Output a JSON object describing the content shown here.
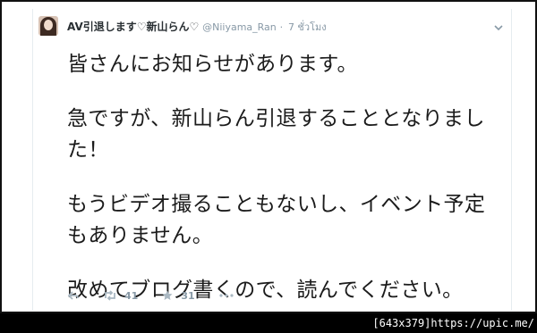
{
  "tweet": {
    "display_name": "AV引退します♡新山らん♡",
    "handle": "@Niiyama_Ran",
    "separator": "·",
    "time": "7 ชั่วโมง",
    "text_lines": [
      "皆さんにお知らせがあります。",
      "急ですが、新山らん引退することとなりまし",
      "た！",
      "もうビデオ撮ることもないし、イベント予定",
      "もありません。",
      "改めてブログ書くので、読んでください。"
    ],
    "retweet_count": "41",
    "favorite_count": "31"
  },
  "icons": {
    "reply": "reply-icon",
    "retweet": "retweet-icon",
    "favorite": "star-icon",
    "more": "more-icon",
    "menu": "chevron-down-icon"
  },
  "caption": "[643x379]https://upic.me/"
}
